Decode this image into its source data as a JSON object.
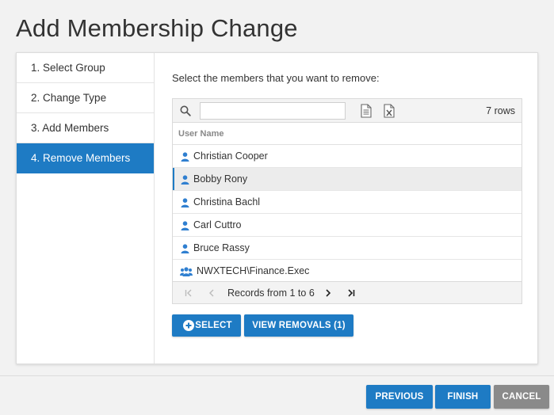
{
  "page": {
    "title": "Add Membership Change"
  },
  "steps": [
    {
      "label": "1. Select Group",
      "active": false
    },
    {
      "label": "2. Change Type",
      "active": false
    },
    {
      "label": "3. Add Members",
      "active": false
    },
    {
      "label": "4. Remove Members",
      "active": true
    }
  ],
  "content": {
    "instruction": "Select the members that you want to remove:",
    "search": {
      "value": "",
      "placeholder": ""
    },
    "toolbar_icons": [
      "search-icon",
      "document-icon",
      "excel-export-icon"
    ],
    "row_count": "7 rows",
    "column_header": "User Name",
    "rows": [
      {
        "name": "Christian Cooper",
        "type": "user",
        "selected": false
      },
      {
        "name": "Bobby Rony",
        "type": "user",
        "selected": true
      },
      {
        "name": "Christina Bachl",
        "type": "user",
        "selected": false
      },
      {
        "name": "Carl Cuttro",
        "type": "user",
        "selected": false
      },
      {
        "name": "Bruce Rassy",
        "type": "user",
        "selected": false
      },
      {
        "name": "NWXTECH\\Finance.Exec",
        "type": "group",
        "selected": false
      }
    ],
    "pager": {
      "text": "Records from 1 to 6"
    },
    "buttons": {
      "select": "SELECT",
      "view_removals": "VIEW REMOVALS (1)"
    }
  },
  "footer": {
    "previous": "PREVIOUS",
    "finish": "FINISH",
    "cancel": "CANCEL"
  },
  "colors": {
    "accent": "#1e7bc4",
    "cancel": "#8a8a8a",
    "background": "#f2f2f2"
  }
}
